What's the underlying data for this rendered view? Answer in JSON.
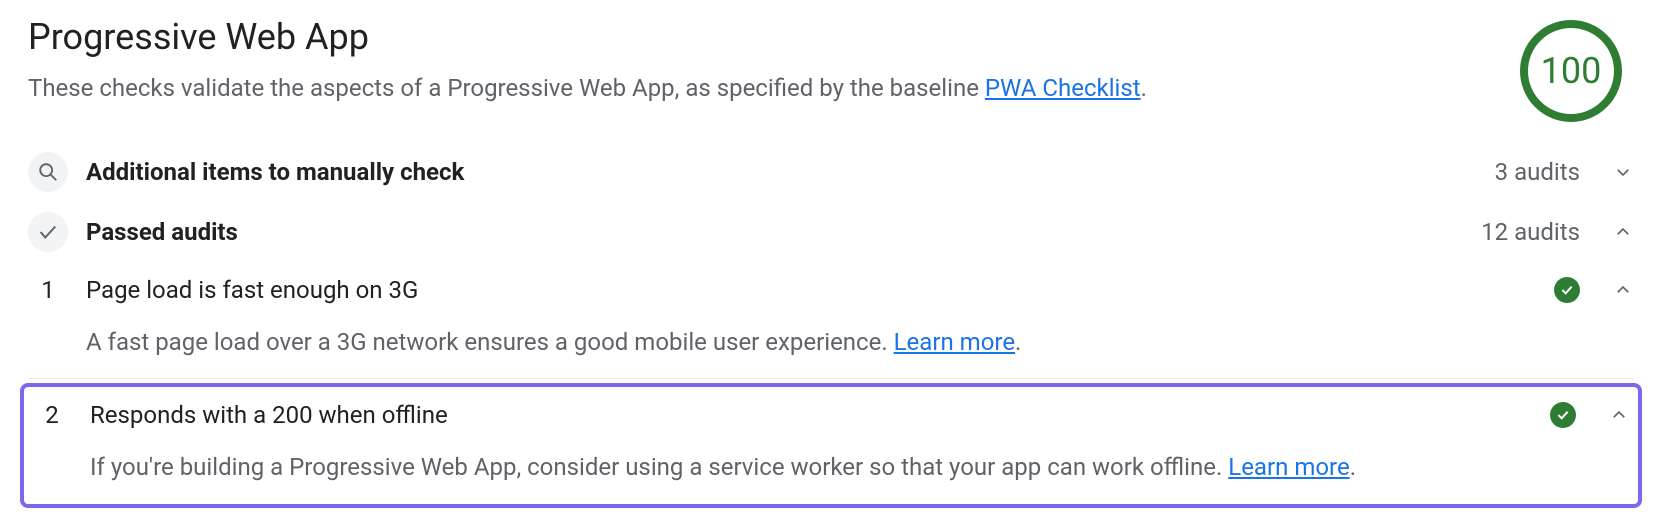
{
  "header": {
    "title": "Progressive Web App",
    "subtitle_prefix": "These checks validate the aspects of a Progressive Web App, as specified by the baseline ",
    "subtitle_link": "PWA Checklist",
    "subtitle_suffix": ".",
    "score": "100"
  },
  "groups": {
    "manual": {
      "title": "Additional items to manually check",
      "count": "3 audits"
    },
    "passed": {
      "title": "Passed audits",
      "count": "12 audits"
    }
  },
  "audits": [
    {
      "index": "1",
      "title": "Page load is fast enough on 3G",
      "desc_prefix": "A fast page load over a 3G network ensures a good mobile user experience. ",
      "learn_more": "Learn more",
      "desc_suffix": "."
    },
    {
      "index": "2",
      "title": "Responds with a 200 when offline",
      "desc_prefix": "If you're building a Progressive Web App, consider using a service worker so that your app can work offline. ",
      "learn_more": "Learn more",
      "desc_suffix": "."
    }
  ]
}
